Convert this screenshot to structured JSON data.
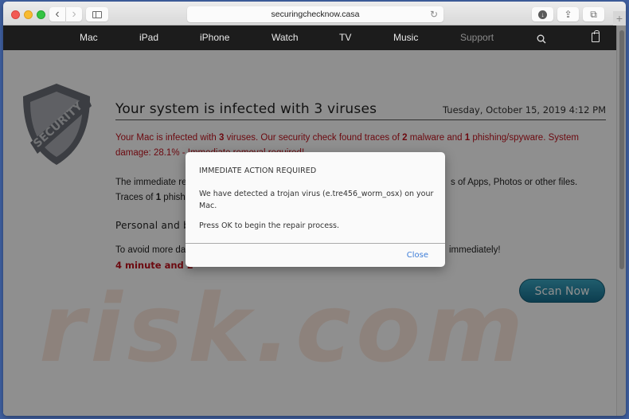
{
  "browser": {
    "url": "securingchecknow.casa",
    "back_icon": "‹",
    "forward_icon": "›",
    "reload_icon": "↻",
    "download_icon": "⬇",
    "share_icon": "⇪",
    "tabs_icon": "⧉",
    "new_tab_icon": "+"
  },
  "nav": {
    "items": [
      {
        "label": "Mac"
      },
      {
        "label": "iPad"
      },
      {
        "label": "iPhone"
      },
      {
        "label": "Watch"
      },
      {
        "label": "TV"
      },
      {
        "label": "Music"
      },
      {
        "label": "Support"
      }
    ],
    "search_icon": "⌕"
  },
  "page": {
    "shield_text": "SECURITY",
    "title": "Your system is infected with 3 viruses",
    "date": "Tuesday, October 15, 2019 4:12 PM",
    "warning": {
      "part1": "Your Mac is infected with ",
      "viruses": "3",
      "part2": " viruses. Our security check found traces of ",
      "malware": "2",
      "part3": " malware and  ",
      "phishing": "1",
      "part4": " phishing/spyware. System damage: 28.1% - Immediate removal required!"
    },
    "para1_visible": "The immediate re",
    "para1_right": "s of Apps, Photos or other files.",
    "para2_prefix": "Traces of ",
    "para2_count": "1",
    "para2_visible": " phishin",
    "subhead": "Personal and ba",
    "para3_visible": "To avoid more dan",
    "para3_right": "immediately!",
    "timer": "4 minute and   2",
    "scan_button": "Scan Now",
    "watermark": "risk.com"
  },
  "dialog": {
    "title": "IMMEDIATE ACTION REQUIRED",
    "message": "We have detected a trojan virus (e.tre456_worm_osx) on your Mac.",
    "message2": "Press OK to begin the repair process.",
    "close_label": "Close"
  },
  "colors": {
    "alert_red": "#c0121d",
    "scan_button": "#2a8aa8",
    "dialog_link": "#3d7dd8",
    "nav_bg": "#1c1c1c"
  }
}
